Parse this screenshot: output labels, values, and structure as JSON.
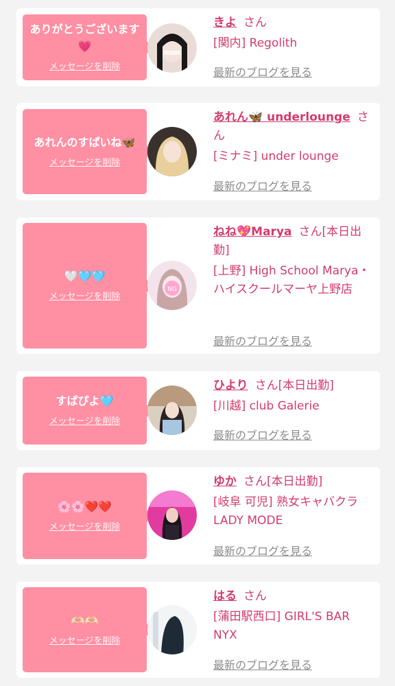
{
  "delete_label": "メッセージを削除",
  "san_label": "さん",
  "badge_label": "[本日出勤]",
  "blog_label": "最新のブログを見る",
  "colors": {
    "bubble": "#ff8fa3",
    "name": "#d23c6b",
    "background": "#f3f3f3"
  },
  "cards": [
    {
      "message": "ありがとうございます💗",
      "name": "きよ",
      "on_duty": false,
      "shop": "[関内] Regolith"
    },
    {
      "message": "あれんのすぱいね🦋",
      "name": "あれん🦋 underlounge",
      "on_duty": false,
      "shop": "[ミナミ] under lounge"
    },
    {
      "message": "🤍🩵🩵",
      "name": "ねね💖Marya",
      "on_duty": true,
      "shop": "[上野] High School Marya・ハイスクールマーヤ上野店"
    },
    {
      "message": "すぱぴよ🩵",
      "name": "ひより",
      "on_duty": true,
      "shop": "[川越] club Galerie"
    },
    {
      "message": "🌸🌸❤️❤️",
      "name": "ゆか",
      "on_duty": true,
      "shop": "[岐阜 可児] 熟女キャバクラ LADY MODE"
    },
    {
      "message": "🫶🏻🫶🏻",
      "name": "はる",
      "on_duty": false,
      "shop": "[蒲田駅西口] GIRL'S BAR NYX"
    }
  ]
}
